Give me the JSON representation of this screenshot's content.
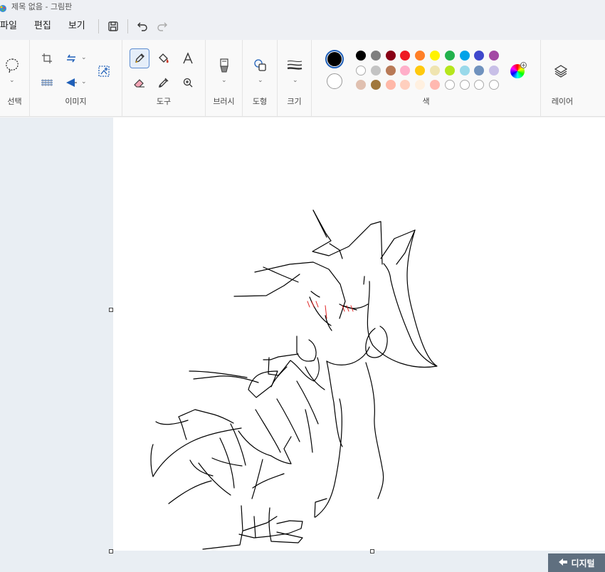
{
  "window": {
    "title": "제목 없음 - 그림판"
  },
  "menu": {
    "file": "파일",
    "edit": "편집",
    "view": "보기"
  },
  "ribbon": {
    "groups": {
      "select": "선택",
      "image": "이미지",
      "tools": "도구",
      "brushes": "브러시",
      "shapes": "도형",
      "size": "크기",
      "colors": "색",
      "layers": "레이어"
    },
    "primary_color": "#000000",
    "secondary_color": "#ffffff",
    "palette_row1": [
      "#000000",
      "#7f7f7f",
      "#880015",
      "#ed1c24",
      "#ff7f27",
      "#fff200",
      "#22b14c",
      "#00a2e8",
      "#3f48cc",
      "#a349a4"
    ],
    "palette_row2": [
      "#ffffff",
      "#c3c3c3",
      "#b97a57",
      "#ffaec9",
      "#ffc90e",
      "#efe4b0",
      "#b5e61d",
      "#99d9ea",
      "#7092be",
      "#c8bfe7"
    ],
    "palette_row3": [
      "#e0c0b0",
      "#a0783c",
      "#ffb8a8",
      "#ffcfbe",
      "#fff0e0",
      "#ffb8b0",
      "",
      "",
      "",
      ""
    ]
  },
  "watermark": {
    "text": "디지털"
  }
}
